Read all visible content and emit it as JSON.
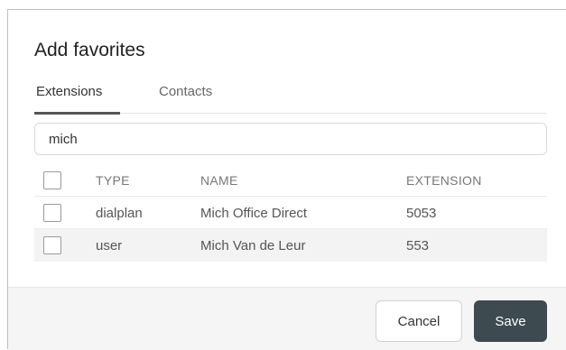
{
  "dialog": {
    "title": "Add favorites",
    "tabs": [
      {
        "label": "Extensions",
        "active": true
      },
      {
        "label": "Contacts",
        "active": false
      }
    ],
    "search": {
      "value": "mich",
      "placeholder": ""
    },
    "table": {
      "headers": {
        "type": "TYPE",
        "name": "NAME",
        "extension": "EXTENSION"
      },
      "rows": [
        {
          "type": "dialplan",
          "name": "Mich Office Direct",
          "extension": "5053",
          "checked": false
        },
        {
          "type": "user",
          "name": "Mich Van de Leur",
          "extension": "553",
          "checked": false
        }
      ]
    },
    "buttons": {
      "cancel": "Cancel",
      "save": "Save"
    }
  },
  "colors": {
    "save_button": "#3d4a4f",
    "footer_bg": "#f5f5f5",
    "row_alt_bg": "#f3f3f3",
    "tab_underline": "#555555"
  }
}
